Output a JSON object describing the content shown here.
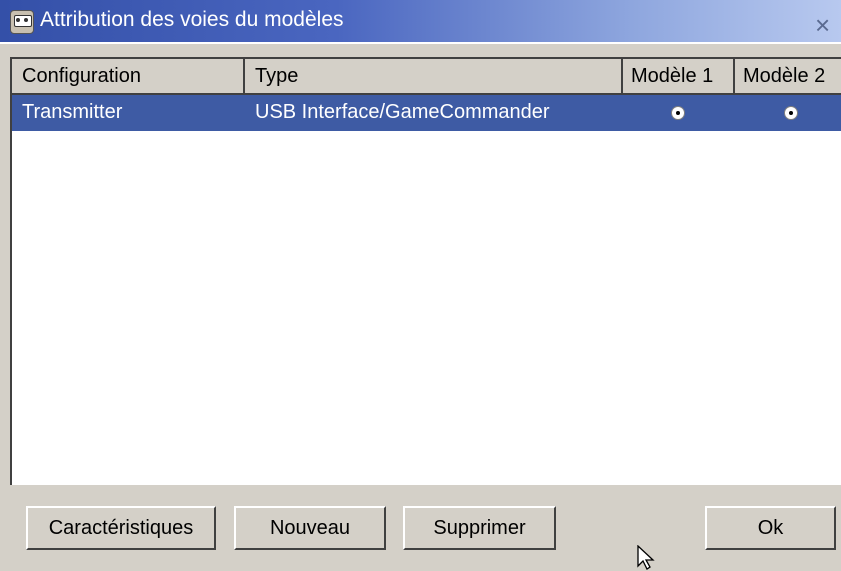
{
  "window": {
    "title": "Attribution des voies du modèles",
    "icon": "transmitter-icon",
    "close_symbol": "×"
  },
  "table": {
    "columns": [
      "Configuration",
      "Type",
      "Modèle 1",
      "Modèle 2"
    ],
    "rows": [
      {
        "configuration": "Transmitter",
        "type": "USB Interface/GameCommander",
        "model1_selected": true,
        "model2_selected": true,
        "selected": true
      }
    ]
  },
  "buttons": {
    "characteristics": "Caractéristiques",
    "new": "Nouveau",
    "delete": "Supprimer",
    "ok": "Ok"
  },
  "colors": {
    "selection": "#3e5ba4",
    "face": "#d4d0c8",
    "title_start": "#3450a8"
  }
}
